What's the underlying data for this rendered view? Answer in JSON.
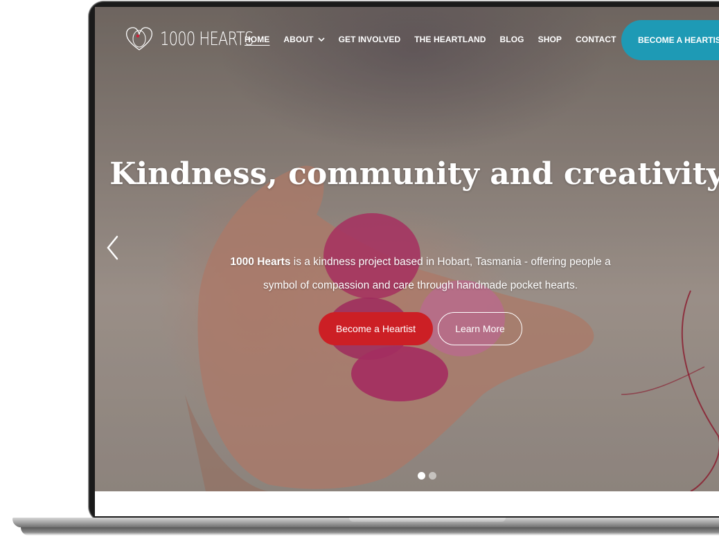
{
  "site": {
    "logo_text": "1000 HEARTS"
  },
  "nav": {
    "items": [
      {
        "label": "HOME",
        "active": true
      },
      {
        "label": "ABOUT",
        "has_dropdown": true
      },
      {
        "label": "GET INVOLVED"
      },
      {
        "label": "THE HEARTLAND"
      },
      {
        "label": "BLOG"
      },
      {
        "label": "SHOP"
      },
      {
        "label": "CONTACT"
      }
    ],
    "cta_label": "BECOME A HEARTIST"
  },
  "hero": {
    "title": "Kindness, community and creativity.",
    "desc_bold": "1000 Hearts",
    "desc_rest": " is a kindness project based in Hobart, Tasmania - offering people a symbol of compassion and care through handmade pocket hearts.",
    "primary_button": "Become a Heartist",
    "secondary_button": "Learn More",
    "slides": {
      "count": 2,
      "active": 1
    }
  },
  "colors": {
    "cta_nav": "#1e9ab5",
    "primary_button": "#cc1f25"
  },
  "icons": {
    "logo": "heart-outline-icon",
    "dropdown": "chevron-down-icon",
    "prev": "chevron-left-icon"
  }
}
